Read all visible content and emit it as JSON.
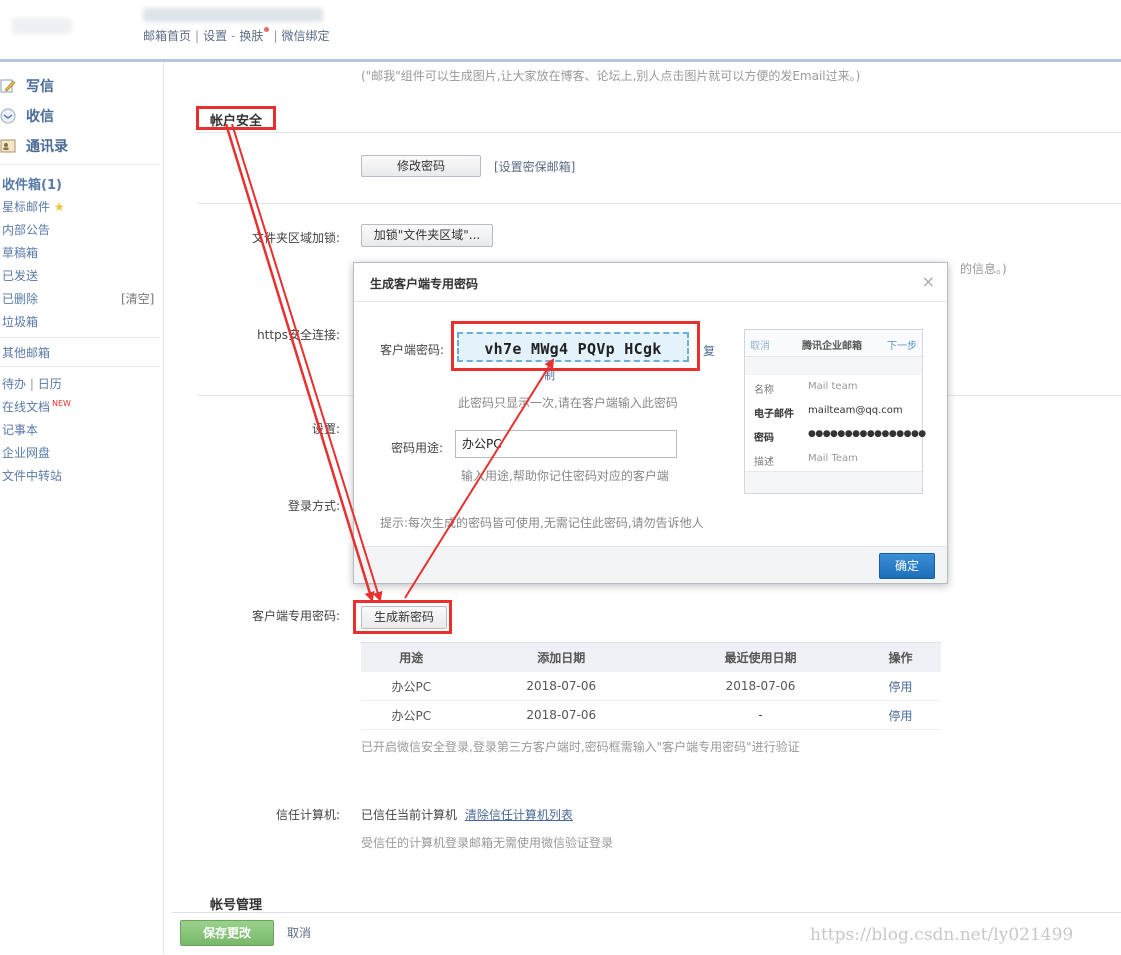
{
  "topbar": {
    "links": [
      "邮箱首页",
      "设置",
      "换肤",
      "微信绑定"
    ],
    "separators": [
      "|",
      "-",
      "|"
    ]
  },
  "sidebar": {
    "main": [
      {
        "label": "写信",
        "icon": "pencil-icon"
      },
      {
        "label": "收信",
        "icon": "inbox-icon"
      },
      {
        "label": "通讯录",
        "icon": "contacts-icon"
      }
    ],
    "inbox": "收件箱(1)",
    "starred": "星标邮件",
    "folders": [
      "内部公告",
      "草稿箱",
      "已发送",
      "已删除",
      "垃圾箱"
    ],
    "clear": "[清空]",
    "other": "其他邮箱",
    "todo": "待办",
    "calendar": "日历",
    "online_doc": "在线文档",
    "new_badge": "NEW",
    "tools": [
      "记事本",
      "企业网盘",
      "文件中转站"
    ]
  },
  "content": {
    "top_hint": "(\"邮我\"组件可以生成图片,让大家放在博客、论坛上,别人点击图片就可以方便的发Email过来。)",
    "account_security": "帐户安全",
    "change_password": "修改密码",
    "security_email": "[设置密保邮箱]",
    "folder_lock_label": "文件夹区域加锁:",
    "folder_lock_button": "加锁\"文件夹区域\"...",
    "folder_lock_hint_tail": "的信息。)",
    "https_label": "https安全连接:",
    "settings_label": "设置:",
    "login_label": "登录方式:",
    "client_pw_label": "客户端专用密码:",
    "generate_button": "生成新密码",
    "table": {
      "headers": [
        "用途",
        "添加日期",
        "最近使用日期",
        "操作"
      ],
      "rows": [
        [
          "办公PC",
          "2018-07-06",
          "2018-07-06",
          "停用"
        ],
        [
          "办公PC",
          "2018-07-06",
          "-",
          "停用"
        ]
      ]
    },
    "wechat_hint": "已开启微信安全登录,登录第三方客户端时,密码框需输入\"客户端专用密码\"进行验证",
    "trusted_label": "信任计算机:",
    "trusted_value": "已信任当前计算机",
    "trusted_clear": "清除信任计算机列表",
    "trusted_hint": "受信任的计算机登录邮箱无需使用微信验证登录",
    "account_manage": "帐号管理"
  },
  "modal": {
    "title": "生成客户端专用密码",
    "close": "×",
    "pw_label": "客户端密码:",
    "password": "vh7e MWg4 PQVp HCgk",
    "copy": "复",
    "copy_tail": "制",
    "once_hint": "此密码只显示一次,请在客户端输入此密码",
    "purpose_label": "密码用途:",
    "purpose_value": "办公PC",
    "purpose_hint": "输入用途,帮助你记住密码对应的客户端",
    "tip": "提示:每次生成的密码皆可使用,无需记住此密码,请勿告诉他人",
    "ok": "确定",
    "phone": {
      "cancel": "取消",
      "title": "腾讯企业邮箱",
      "next": "下一步",
      "rows": [
        [
          "名称",
          "Mail team"
        ],
        [
          "电子邮件",
          "mailteam@qq.com"
        ],
        [
          "密码",
          "●●●●●●●●●●●●●●●●"
        ],
        [
          "描述",
          "Mail Team"
        ]
      ]
    }
  },
  "bottom": {
    "save": "保存更改",
    "cancel": "取消"
  },
  "watermark": "https://blog.csdn.net/ly021499",
  "colors": {
    "link": "#5a6b85",
    "sidebar": "#4a6a98",
    "annotation_red": "#e8302e",
    "ok_blue": "#1c6fb9",
    "save_green": "#77b86a"
  }
}
